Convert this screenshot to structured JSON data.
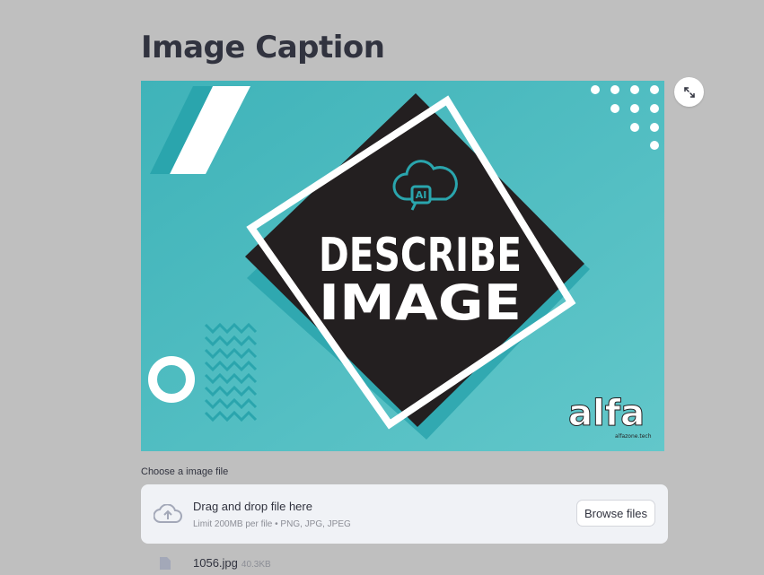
{
  "header": {
    "title": "Image Caption"
  },
  "image": {
    "headline_line1": "DESCRIBE",
    "headline_line2": "IMAGE",
    "badge_text": "AI",
    "logo_text": "alfa",
    "logo_subtext": "alfazone.tech",
    "colors": {
      "background": "#5cc3c7",
      "dark": "#231f20",
      "accent": "#2aa5ad"
    }
  },
  "fullscreen": {
    "icon": "expand-icon"
  },
  "uploader": {
    "label": "Choose a image file",
    "drop_title": "Drag and drop file here",
    "limit": "Limit 200MB per file • PNG, JPG, JPEG",
    "browse_label": "Browse files",
    "icon": "cloud-upload-icon"
  },
  "uploaded_file": {
    "name": "1056.jpg",
    "size": "40.3KB",
    "icon": "file-icon"
  }
}
